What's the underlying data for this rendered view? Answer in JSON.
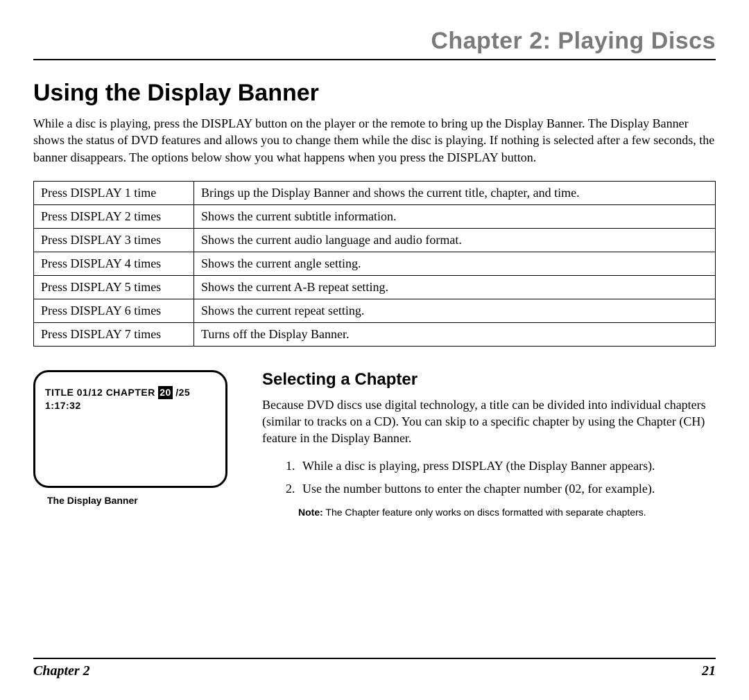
{
  "header": {
    "chapter_title": "Chapter 2: Playing Discs"
  },
  "section": {
    "title": "Using the Display Banner",
    "intro": "While a disc is playing, press the DISPLAY button on the player or the remote to bring up the Display Banner. The Display Banner shows the status of DVD features and allows you to change them while the disc is playing. If nothing is selected after a few seconds, the banner disappears. The options below show you what happens when you press the DISPLAY button."
  },
  "table_rows": [
    {
      "action": "Press DISPLAY 1 time",
      "result": "Brings up the Display Banner and shows the current title, chapter, and time."
    },
    {
      "action": "Press DISPLAY 2 times",
      "result": "Shows the current subtitle information."
    },
    {
      "action": "Press DISPLAY 3 times",
      "result": "Shows the current audio language and audio format."
    },
    {
      "action": "Press DISPLAY 4 times",
      "result": "Shows the current angle setting."
    },
    {
      "action": "Press DISPLAY 5 times",
      "result": "Shows the current A-B repeat setting."
    },
    {
      "action": "Press DISPLAY 6 times",
      "result": "Shows the current repeat setting."
    },
    {
      "action": "Press DISPLAY 7 times",
      "result": "Turns off the Display Banner."
    }
  ],
  "banner": {
    "pre_text": "TITLE  01/12   CHAPTER ",
    "highlight": "20",
    "post_text": " /25",
    "time": "1:17:32",
    "caption": "The Display Banner"
  },
  "subsection": {
    "title": "Selecting a Chapter",
    "body": "Because DVD discs use digital technology, a title can be divided into individual chapters (similar to tracks on a CD). You can skip to a specific chapter by using the Chapter (CH) feature in the Display Banner.",
    "steps": [
      "While a disc is playing, press DISPLAY (the Display Banner appears).",
      "Use the number buttons to enter the chapter number (02, for example)."
    ],
    "note_label": "Note:",
    "note_text": " The Chapter feature only works on discs formatted with separate chapters."
  },
  "footer": {
    "left": "Chapter 2",
    "right": "21"
  }
}
